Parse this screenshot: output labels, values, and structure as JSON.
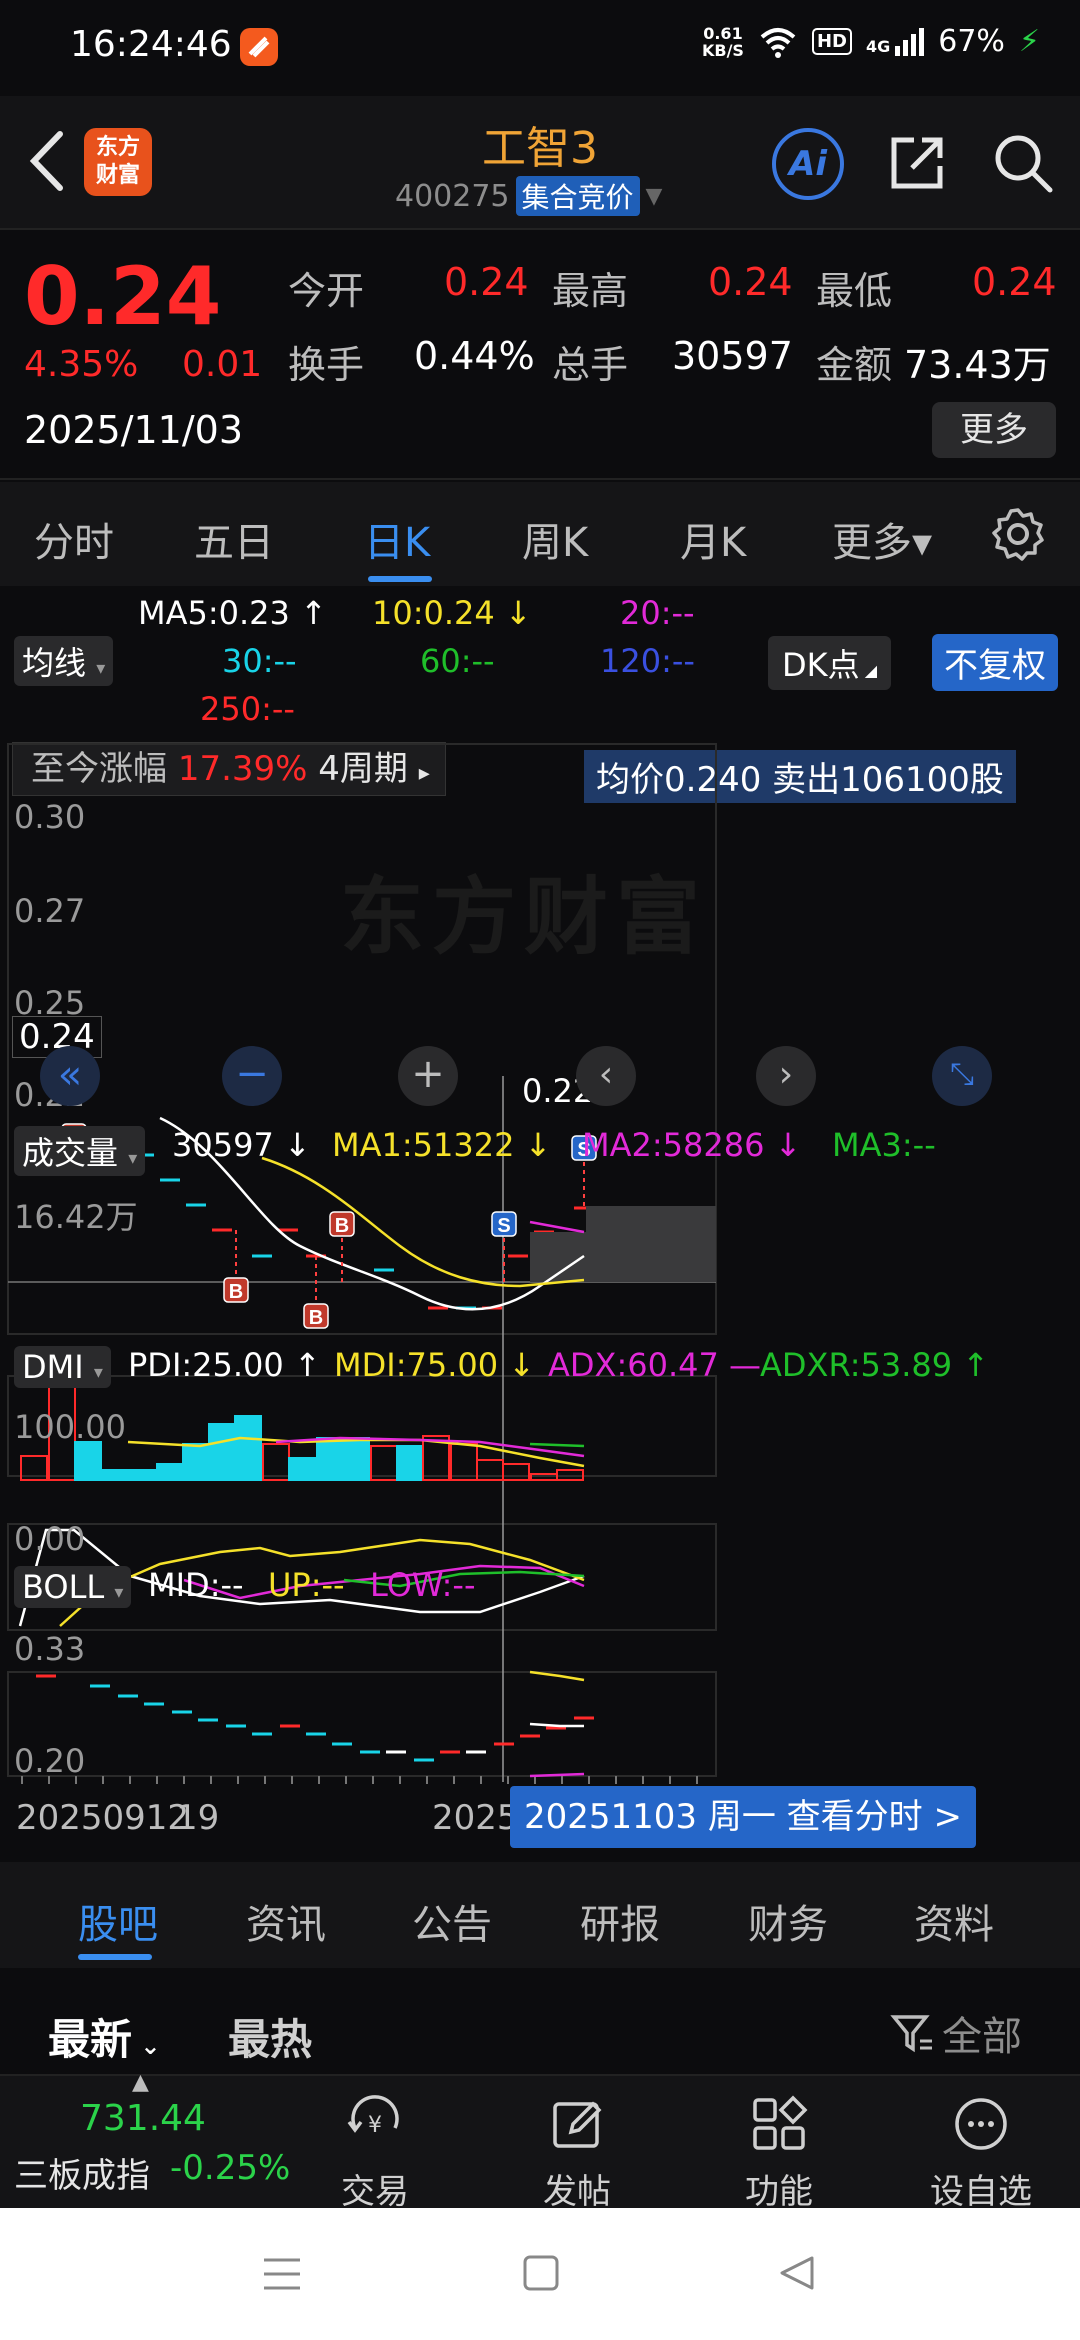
{
  "status_bar": {
    "time": "16:24:46",
    "net_speed": "0.61\nKB/S",
    "hd": "HD",
    "signal": "4G",
    "battery": "67%"
  },
  "header": {
    "logo_text": "东方\n财富",
    "stock_name": "工智3",
    "stock_code": "400275",
    "auction_tag": "集合竞价",
    "ai_label": "Ai"
  },
  "quote": {
    "price": "0.24",
    "change_pct": "4.35%",
    "change": "0.01",
    "date": "2025/11/03",
    "open_label": "今开",
    "open": "0.24",
    "high_label": "最高",
    "high": "0.24",
    "low_label": "最低",
    "low": "0.24",
    "turnover_label": "换手",
    "turnover": "0.44%",
    "volume_label": "总手",
    "volume": "30597",
    "amount_label": "金额",
    "amount": "73.43万",
    "more_label": "更多"
  },
  "period_tabs": [
    "分时",
    "五日",
    "日K",
    "周K",
    "月K",
    "更多▾"
  ],
  "chart": {
    "ma_button": "均线",
    "ma": {
      "ma5": "MA5:0.23 ↑",
      "ma10": "10:0.24 ↓",
      "ma20": "20:--",
      "ma30": "30:--",
      "ma60": "60:--",
      "ma120": "120:--",
      "ma250": "250:--"
    },
    "dk_button": "DK点",
    "fq_button": "不复权",
    "period_gain_label": "至今涨幅",
    "period_gain": "17.39%",
    "period_range": "4周期",
    "tooltip": "均价0.240  卖出106100股",
    "watermark": "东方财富",
    "price_axis": [
      "0.30",
      "0.27",
      "0.25",
      "0.22"
    ],
    "current_price_tag": "0.24",
    "min_label": "0.22->",
    "vol_button": "成交量",
    "vol_values": {
      "vol": "30597 ↓",
      "ma1": "MA1:51322 ↓",
      "ma2": "MA2:58286 ↓",
      "ma3": "MA3:--"
    },
    "vol_axis_max": "16.42万",
    "dmi_button": "DMI",
    "dmi_values": {
      "pdi": "PDI:25.00 ↑",
      "mdi": "MDI:75.00 ↓",
      "adx": "ADX:60.47 —",
      "adxr": "ADXR:53.89 ↑"
    },
    "dmi_axis": [
      "100.00",
      "0.00"
    ],
    "boll_button": "BOLL",
    "boll_values": {
      "mid": "MID:--",
      "up": "UP:--",
      "low": "LOW:--"
    },
    "boll_axis": [
      "0.33",
      "0.20"
    ],
    "date_start": "20250912",
    "date_mid": "2025",
    "date_frag": "19",
    "date_bar": "20251103 周一 查看分时 >",
    "marker_b": "B",
    "marker_s": "S",
    "colors": {
      "up": "#ff2a2a",
      "down": "#19d4e8",
      "ma5": "#ffffff",
      "ma10": "#f5e12a",
      "ma20": "#e22ad8",
      "ma30": "#19d4e8",
      "ma60": "#1fbf2a",
      "ma120": "#3a50e0",
      "ma250": "#ff2a2a"
    }
  },
  "bottom_tabs": [
    "股吧",
    "资讯",
    "公告",
    "研报",
    "财务",
    "资料"
  ],
  "sort": {
    "latest": "最新",
    "hot": "最热",
    "filter_all": "全部"
  },
  "toolbar": {
    "index_value": "731.44",
    "index_name": "三板成指",
    "index_change": "-0.25%",
    "trade": "交易",
    "post": "发帖",
    "func": "功能",
    "watch": "设自选"
  }
}
